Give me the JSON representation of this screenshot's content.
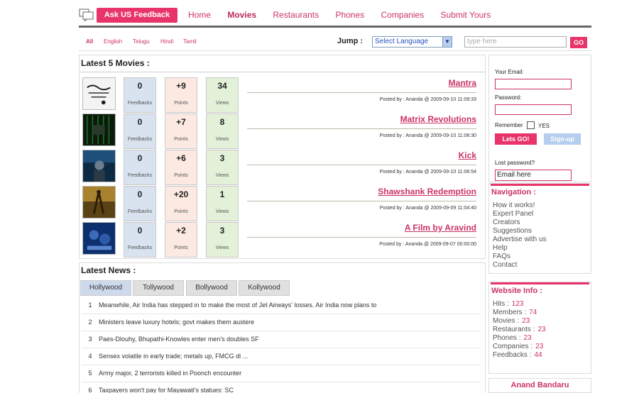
{
  "header": {
    "brand": "Ask US Feedback",
    "nav": [
      "Home",
      "Movies",
      "Restaurants",
      "Phones",
      "Companies",
      "Submit Yours"
    ],
    "active_nav": "Movies"
  },
  "langbar": {
    "languages": [
      "All",
      "English",
      "Telugu",
      "Hindi",
      "Tamil"
    ],
    "jump_label": "Jump :",
    "select_value": "Select Language",
    "search_placeholder": "type here",
    "go_label": "GO"
  },
  "movies": {
    "title": "Latest 5 Movies :",
    "stat_labels": {
      "feedbacks": "Feedbacks",
      "points": "Points",
      "views": "Views"
    },
    "items": [
      {
        "title": "Mantra",
        "feedbacks": "0",
        "points": "+9",
        "views": "34",
        "posted": "Posted by : Ananda @ 2009-09-10 11:09:33"
      },
      {
        "title": "Matrix Revolutions",
        "feedbacks": "0",
        "points": "+7",
        "views": "8",
        "posted": "Posted by : Ananda @ 2009-09-10 11:08:30"
      },
      {
        "title": "Kick",
        "feedbacks": "0",
        "points": "+6",
        "views": "3",
        "posted": "Posted by : Ananda @ 2009-09-10 11:06:54"
      },
      {
        "title": "Shawshank Redemption",
        "feedbacks": "0",
        "points": "+20",
        "views": "1",
        "posted": "Posted by : Ananda @ 2009-09-09 11:04:40"
      },
      {
        "title": "A Film by Aravind",
        "feedbacks": "0",
        "points": "+2",
        "views": "3",
        "posted": "Posted by : Ananda @ 2009-09-07 00:00:00"
      }
    ]
  },
  "news": {
    "title": "Latest News :",
    "tabs": [
      "Hollywood",
      "Tollywood",
      "Bollywood",
      "Kollywood"
    ],
    "items": [
      {
        "n": "1",
        "text": "Meanwhile, Air India has stepped in to make the most of Jet Airways' losses. Air India now plans to"
      },
      {
        "n": "2",
        "text": "Ministers leave luxury hotels; govt makes them austere"
      },
      {
        "n": "3",
        "text": "Paes-Dlouhy, Bhupathi-Knowles enter men's doubles SF"
      },
      {
        "n": "4",
        "text": "Sensex volatile in early trade; metals up, FMCG di ..."
      },
      {
        "n": "5",
        "text": "Army major, 2 terrorists killed in Poonch encounter"
      },
      {
        "n": "6",
        "text": "Taxpayers won't pay for Mayawati's statues: SC"
      }
    ]
  },
  "login": {
    "email_label": "Your Email:",
    "password_label": "Password:",
    "remember_label": "Remember",
    "yes_label": "YES",
    "login_button": "Lets GO!",
    "signup_button": "Sign-up",
    "lost_password_label": "Lost password?",
    "lost_email_value": "Email here"
  },
  "navigation": {
    "title": "Navigation :",
    "items": [
      "How it works!",
      "Expert Panel",
      "Creators",
      "Suggestions",
      "Advertise with us",
      "Help",
      "FAQs",
      "Contact"
    ]
  },
  "website_info": {
    "title": "Website Info :",
    "items": [
      {
        "label": "Hits :",
        "value": "123"
      },
      {
        "label": "Members :",
        "value": "74"
      },
      {
        "label": "Movies :",
        "value": "23"
      },
      {
        "label": "Restaurants :",
        "value": "23"
      },
      {
        "label": "Phones :",
        "value": "23"
      },
      {
        "label": "Companies :",
        "value": "23"
      },
      {
        "label": "Feedbacks :",
        "value": "44"
      }
    ]
  },
  "author": "Anand Bandaru",
  "colors": {
    "accent": "#e8346a",
    "link": "#cc3366",
    "feedbacks_bg": "#d8e3ef",
    "points_bg": "#fbe9e2",
    "views_bg": "#e3f1d9"
  }
}
